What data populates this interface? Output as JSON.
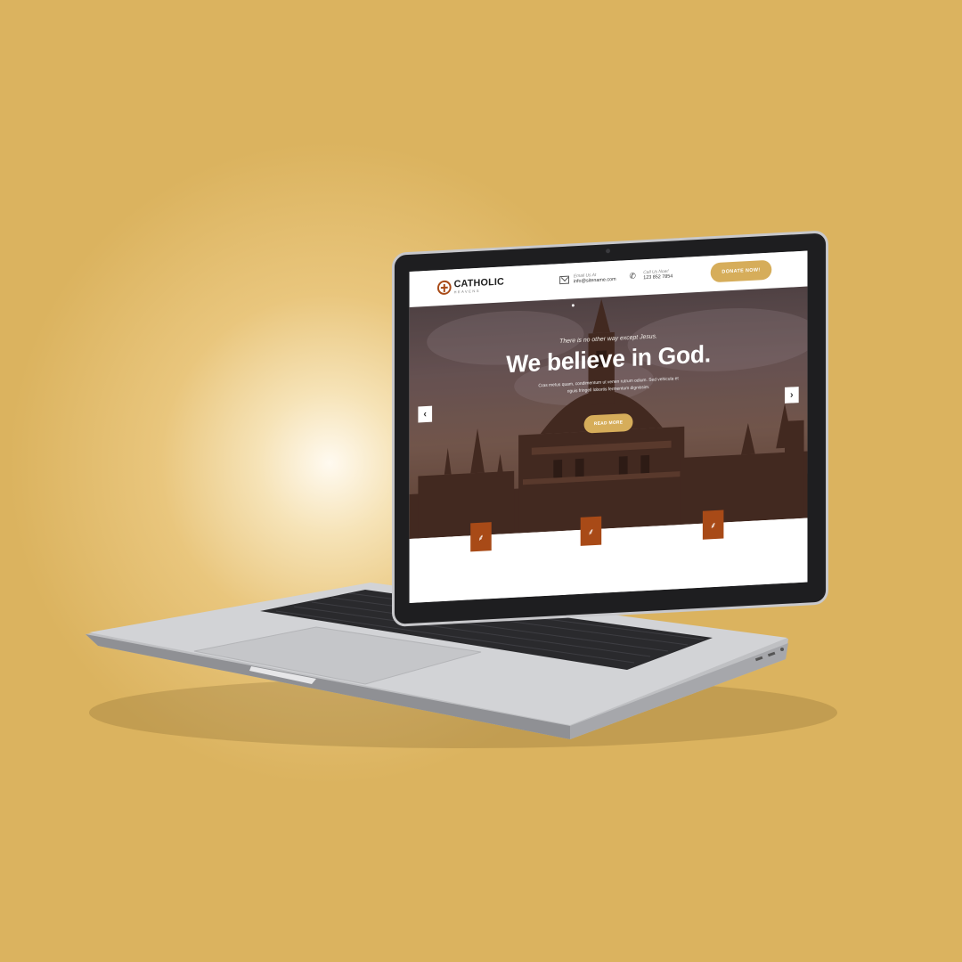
{
  "header": {
    "logo_title": "CATHOLIC",
    "logo_subtitle": "HEAVENS",
    "email_label": "Email Us At",
    "email_value": "info@sitename.com",
    "phone_label": "Call Us Now!",
    "phone_value": "123 852 7854",
    "donate_label": "DONATE NOW!"
  },
  "hero": {
    "kicker": "There is no other way except Jesus.",
    "title": "We believe in God.",
    "body": "Cras metus quam, condimentum ut venen rutrum odium. Sed vehicula et riguis fringell lobortis fermentum dignissim.",
    "cta_label": "READ MORE",
    "prev_arrow": "‹",
    "next_arrow": "›"
  },
  "features": {
    "icons": [
      "wheat-icon",
      "wheat-icon",
      "wheat-icon"
    ],
    "glyph": "⸙"
  },
  "colors": {
    "background": "#dbb35f",
    "accent_gold": "#d6ad5a",
    "accent_rust": "#a84a17"
  }
}
